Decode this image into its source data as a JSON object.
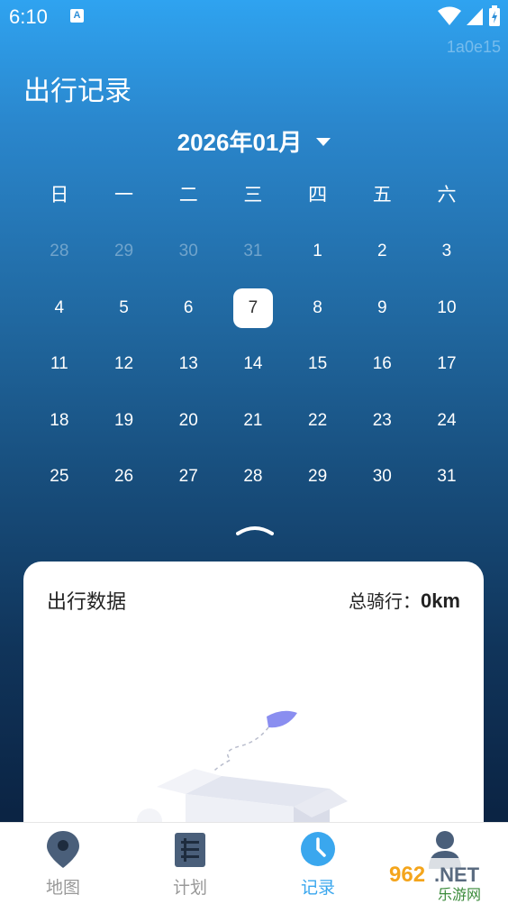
{
  "status_bar": {
    "time": "6:10",
    "notification_icon": "A",
    "device_id": "1a0e15"
  },
  "page": {
    "title": "出行记录"
  },
  "calendar": {
    "month_label": "2026年01月",
    "weekdays": [
      "日",
      "一",
      "二",
      "三",
      "四",
      "五",
      "六"
    ],
    "weeks": [
      [
        {
          "d": "28",
          "m": true
        },
        {
          "d": "29",
          "m": true
        },
        {
          "d": "30",
          "m": true
        },
        {
          "d": "31",
          "m": true
        },
        {
          "d": "1"
        },
        {
          "d": "2"
        },
        {
          "d": "3"
        }
      ],
      [
        {
          "d": "4"
        },
        {
          "d": "5"
        },
        {
          "d": "6"
        },
        {
          "d": "7",
          "sel": true
        },
        {
          "d": "8"
        },
        {
          "d": "9"
        },
        {
          "d": "10"
        }
      ],
      [
        {
          "d": "11"
        },
        {
          "d": "12"
        },
        {
          "d": "13"
        },
        {
          "d": "14"
        },
        {
          "d": "15"
        },
        {
          "d": "16"
        },
        {
          "d": "17"
        }
      ],
      [
        {
          "d": "18"
        },
        {
          "d": "19"
        },
        {
          "d": "20"
        },
        {
          "d": "21"
        },
        {
          "d": "22"
        },
        {
          "d": "23"
        },
        {
          "d": "24"
        }
      ],
      [
        {
          "d": "25"
        },
        {
          "d": "26"
        },
        {
          "d": "27"
        },
        {
          "d": "28"
        },
        {
          "d": "29"
        },
        {
          "d": "30"
        },
        {
          "d": "31"
        }
      ]
    ],
    "selected_day": "7"
  },
  "card": {
    "title": "出行数据",
    "total_label": "总骑行：",
    "total_value": "0km"
  },
  "tabs": [
    {
      "label": "地图",
      "icon": "map-pin-icon",
      "active": false
    },
    {
      "label": "计划",
      "icon": "plan-list-icon",
      "active": false
    },
    {
      "label": "记录",
      "icon": "clock-icon",
      "active": true
    },
    {
      "label": "我的",
      "icon": "profile-icon",
      "active": false
    }
  ],
  "watermark": "962.NET 乐游网",
  "colors": {
    "accent": "#3aa7ee",
    "bg_top": "#2fa3f0",
    "bg_bottom": "#0a2040",
    "tab_inactive": "#999999"
  }
}
